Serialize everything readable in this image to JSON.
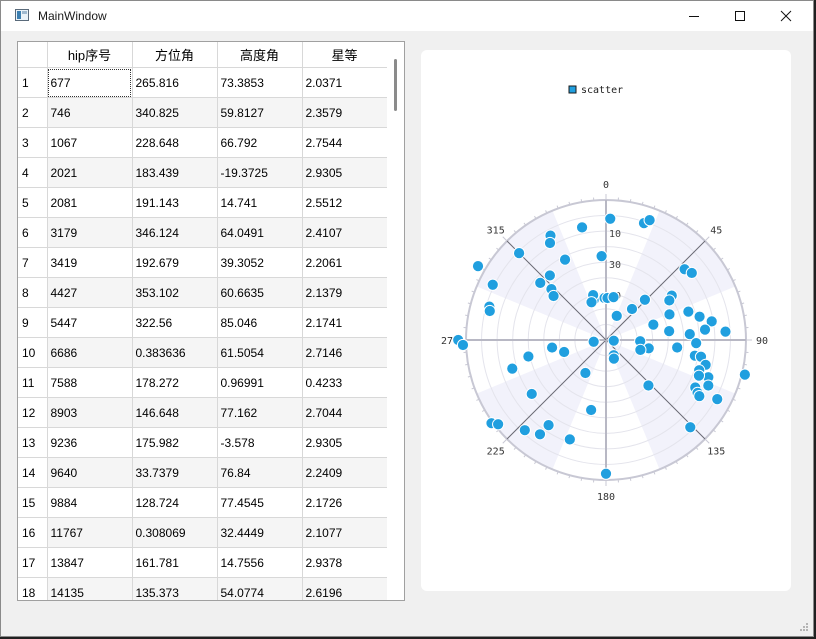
{
  "window": {
    "title": "MainWindow"
  },
  "table": {
    "columns": [
      "hip序号",
      "方位角",
      "高度角",
      "星等"
    ],
    "rows": [
      {
        "n": "1",
        "hip": "677",
        "az": "265.816",
        "alt": "73.3853",
        "mag": "2.0371"
      },
      {
        "n": "2",
        "hip": "746",
        "az": "340.825",
        "alt": "59.8127",
        "mag": "2.3579"
      },
      {
        "n": "3",
        "hip": "1067",
        "az": "228.648",
        "alt": "66.792",
        "mag": "2.7544"
      },
      {
        "n": "4",
        "hip": "2021",
        "az": "183.439",
        "alt": "-19.3725",
        "mag": "2.9305"
      },
      {
        "n": "5",
        "hip": "2081",
        "az": "191.143",
        "alt": "14.741",
        "mag": "2.5512"
      },
      {
        "n": "6",
        "hip": "3179",
        "az": "346.124",
        "alt": "64.0491",
        "mag": "2.4107"
      },
      {
        "n": "7",
        "hip": "3419",
        "az": "192.679",
        "alt": "39.3052",
        "mag": "2.2061"
      },
      {
        "n": "8",
        "hip": "4427",
        "az": "353.102",
        "alt": "60.6635",
        "mag": "2.1379"
      },
      {
        "n": "9",
        "hip": "5447",
        "az": "322.56",
        "alt": "85.046",
        "mag": "2.1741"
      },
      {
        "n": "10",
        "hip": "6686",
        "az": "0.383636",
        "alt": "61.5054",
        "mag": "2.7146"
      },
      {
        "n": "11",
        "hip": "7588",
        "az": "178.272",
        "alt": "0.96991",
        "mag": "0.4233"
      },
      {
        "n": "12",
        "hip": "8903",
        "az": "146.648",
        "alt": "77.162",
        "mag": "2.7044"
      },
      {
        "n": "13",
        "hip": "9236",
        "az": "175.982",
        "alt": "-3.578",
        "mag": "2.9305"
      },
      {
        "n": "14",
        "hip": "9640",
        "az": "33.7379",
        "alt": "76.84",
        "mag": "2.2409"
      },
      {
        "n": "15",
        "hip": "9884",
        "az": "128.724",
        "alt": "77.4545",
        "mag": "2.1726"
      },
      {
        "n": "16",
        "hip": "11767",
        "az": "0.308069",
        "alt": "32.4449",
        "mag": "2.1077"
      },
      {
        "n": "17",
        "hip": "13847",
        "az": "161.781",
        "alt": "14.7556",
        "mag": "2.9378"
      },
      {
        "n": "18",
        "hip": "14135",
        "az": "135.373",
        "alt": "54.0774",
        "mag": "2.6196"
      }
    ]
  },
  "chart_data": {
    "type": "scatter",
    "polar": true,
    "legend": {
      "label": "scatter",
      "placement": "top-center"
    },
    "series_color": "#209fdf",
    "angular_labels": [
      "0",
      "45",
      "90",
      "135",
      "180",
      "225",
      "270",
      "315"
    ],
    "radial_labels": [
      "10",
      "30",
      "50"
    ],
    "radial_range": [
      90,
      0
    ],
    "points": [
      {
        "az": 2,
        "r": 78
      },
      {
        "az": 18,
        "r": 79
      },
      {
        "az": 20,
        "r": 82
      },
      {
        "az": -12,
        "r": 74
      },
      {
        "az": -28,
        "r": 76
      },
      {
        "az": -30,
        "r": 72
      },
      {
        "az": -3,
        "r": 54
      },
      {
        "az": -27,
        "r": 58
      },
      {
        "az": -41,
        "r": 55
      },
      {
        "az": -47,
        "r": 48
      },
      {
        "az": -50,
        "r": 44
      },
      {
        "az": -49,
        "r": 56
      },
      {
        "az": -64,
        "r": 81
      },
      {
        "az": -74,
        "r": 78
      },
      {
        "az": -76,
        "r": 77
      },
      {
        "az": -107,
        "r": 63
      },
      {
        "az": -98,
        "r": 35
      },
      {
        "az": -102,
        "r": 51
      },
      {
        "az": -106,
        "r": 28
      },
      {
        "az": -126,
        "r": 59
      },
      {
        "az": -138,
        "r": 78
      },
      {
        "az": -146,
        "r": 66
      },
      {
        "az": -145,
        "r": 74
      },
      {
        "az": -160,
        "r": 68
      },
      {
        "az": -168,
        "r": 46
      },
      {
        "az": 180,
        "r": 86
      },
      {
        "az": -148,
        "r": 25
      },
      {
        "az": 48,
        "r": 68
      },
      {
        "az": 52,
        "r": 70
      },
      {
        "az": 44,
        "r": 36
      },
      {
        "az": 56,
        "r": 51
      },
      {
        "az": 58,
        "r": 48
      },
      {
        "az": 68,
        "r": 44
      },
      {
        "az": 71,
        "r": 56
      },
      {
        "az": 80,
        "r": 69
      },
      {
        "az": 76,
        "r": 62
      },
      {
        "az": 86,
        "r": 77
      },
      {
        "az": 84,
        "r": 64
      },
      {
        "az": 86,
        "r": 54
      },
      {
        "az": 82,
        "r": 41
      },
      {
        "az": 92,
        "r": 58
      },
      {
        "az": 100,
        "r": 58
      },
      {
        "az": 101,
        "r": 28
      },
      {
        "az": 96,
        "r": 46
      },
      {
        "az": 100,
        "r": 62
      },
      {
        "az": 104,
        "r": 66
      },
      {
        "az": 108,
        "r": 63
      },
      {
        "az": 110,
        "r": 70
      },
      {
        "az": 111,
        "r": 64
      },
      {
        "az": 114,
        "r": 72
      },
      {
        "az": 118,
        "r": 65
      },
      {
        "az": 120,
        "r": 68
      },
      {
        "az": 121,
        "r": 70
      },
      {
        "az": 136,
        "r": 78
      },
      {
        "az": 137,
        "r": 40
      },
      {
        "az": 104,
        "r": 92
      },
      {
        "az": 118,
        "r": 81
      },
      {
        "az": -98,
        "r": 8
      },
      {
        "az": -17,
        "r": 27
      },
      {
        "az": -16,
        "r": 30
      },
      {
        "az": -2,
        "r": 27
      },
      {
        "az": 2,
        "r": 27
      },
      {
        "az": 10,
        "r": 28
      },
      {
        "az": 24,
        "r": 17
      },
      {
        "az": 40,
        "r": 26
      },
      {
        "az": 72,
        "r": 32
      },
      {
        "az": 92,
        "r": 22
      },
      {
        "az": 153,
        "r": 11
      },
      {
        "az": 157,
        "r": 13
      },
      {
        "az": -90,
        "r": 95
      },
      {
        "az": -92,
        "r": 92
      },
      {
        "az": -60,
        "r": 95
      },
      {
        "az": -45,
        "r": 79
      },
      {
        "az": 106,
        "r": 23
      },
      {
        "az": 95,
        "r": 5
      },
      {
        "az": -21,
        "r": 26
      },
      {
        "az": -126,
        "r": 91
      },
      {
        "az": -128,
        "r": 88
      }
    ]
  }
}
